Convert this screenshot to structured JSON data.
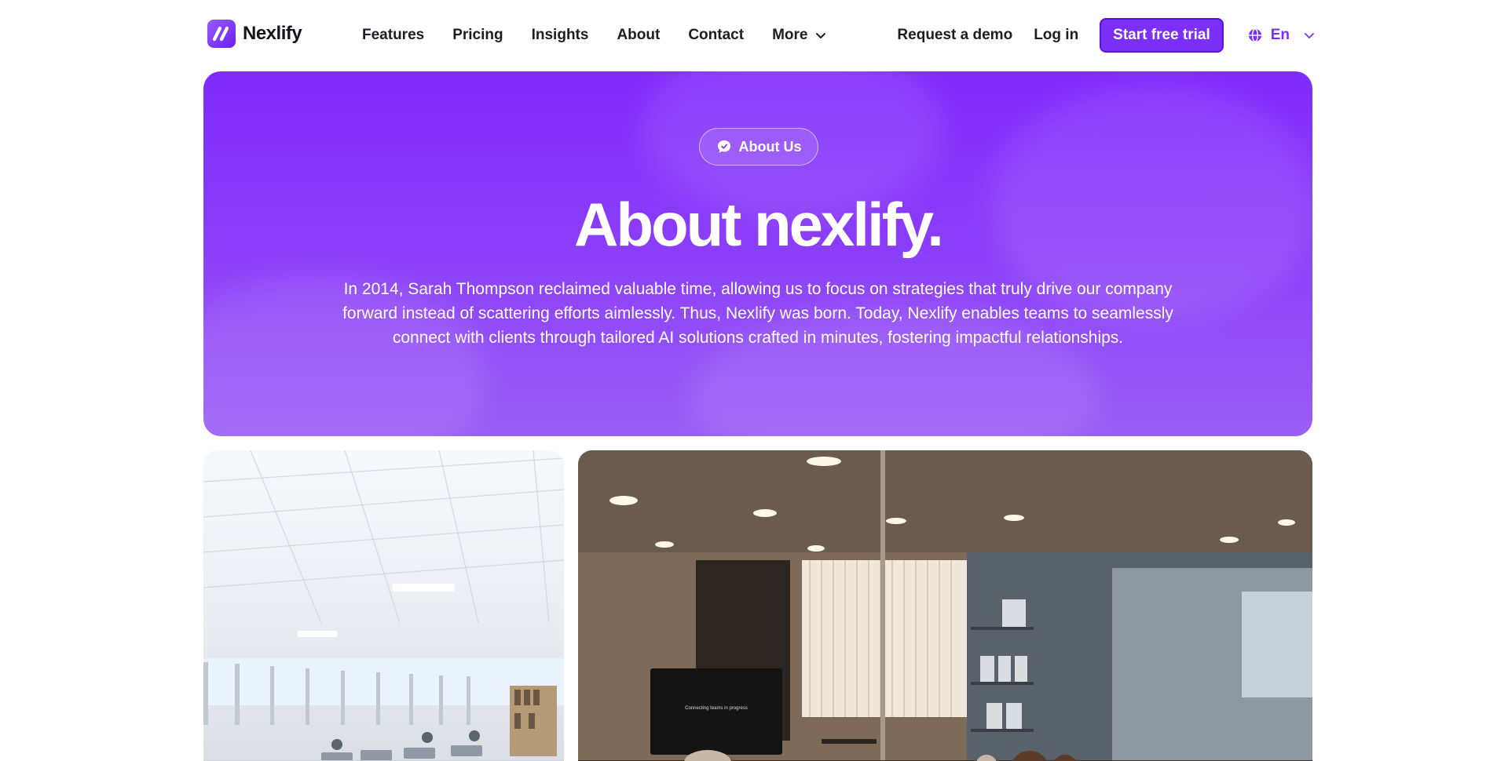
{
  "brand": {
    "name": "Nexlify"
  },
  "nav": {
    "items": [
      {
        "label": "Features"
      },
      {
        "label": "Pricing"
      },
      {
        "label": "Insights"
      },
      {
        "label": "About"
      },
      {
        "label": "Contact"
      },
      {
        "label": "More"
      }
    ]
  },
  "actions": {
    "demo_label": "Request a demo",
    "login_label": "Log in",
    "trial_label": "Start free trial",
    "language": "En"
  },
  "hero": {
    "badge": "About Us",
    "title": "About nexlify.",
    "text": "In 2014, Sarah Thompson reclaimed valuable time, allowing us to focus on strategies that truly drive our company forward instead of scattering efforts aimlessly. Thus, Nexlify was born. Today, Nexlify enables teams to seamlessly connect with clients through tailored AI solutions crafted in minutes, fostering impactful relationships."
  },
  "photos": {
    "left": {
      "screen_text": ""
    },
    "right": {
      "screen_text": "Connecting teams in progress"
    }
  },
  "colors": {
    "accent": "#7b2ff7",
    "accent_border": "#5a12d8",
    "hero_top": "#7f2bfb",
    "hero_bottom": "#9a5ef5",
    "text_dark": "#1d1d25"
  },
  "icons": {
    "logo": "nexlify-logo-icon",
    "more": "chevron-down-icon",
    "language": "globe-icon",
    "badge": "chat-bubble-icon"
  }
}
